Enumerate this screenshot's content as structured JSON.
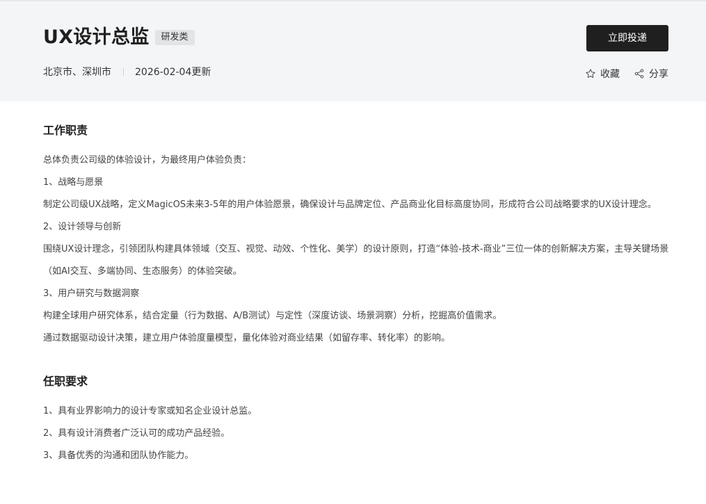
{
  "job": {
    "title": "UX设计总监",
    "category": "研发类",
    "locations": "北京市、深圳市",
    "updated": "2026-02-04更新"
  },
  "actions": {
    "apply_label": "立即投递",
    "favorite_label": "收藏",
    "share_label": "分享",
    "favorite_icon": "star-outline-icon",
    "share_icon": "share-nodes-icon"
  },
  "responsibilities": {
    "title": "工作职责",
    "lines": [
      "总体负责公司级的体验设计，为最终用户体验负责：",
      "1、战略与愿景",
      "制定公司级UX战略，定义MagicOS未来3-5年的用户体验愿景，确保设计与品牌定位、产品商业化目标高度协同，形成符合公司战略要求的UX设计理念。",
      "2、设计领导与创新",
      "围绕UX设计理念，引领团队构建具体领域（交互、视觉、动效、个性化、美学）的设计原则，打造“体验-技术-商业”三位一体的创新解决方案，主导关键场景（如AI交互、多端协同、生态服务）的体验突破。",
      "3、用户研究与数据洞察",
      "构建全球用户研究体系，结合定量（行为数据、A/B测试）与定性（深度访谈、场景洞察）分析，挖掘高价值需求。",
      "通过数据驱动设计决策，建立用户体验度量模型，量化体验对商业结果（如留存率、转化率）的影响。"
    ]
  },
  "requirements": {
    "title": "任职要求",
    "lines": [
      "1、具有业界影响力的设计专家或知名企业设计总监。",
      "2、具有设计消费者广泛认可的成功产品经验。",
      "3、具备优秀的沟通和团队协作能力。"
    ]
  },
  "colors": {
    "header_bg": "#f4f5f7",
    "primary_button": "#1f1f1f",
    "tag_bg": "#e3e4e7",
    "text_primary": "#1f1f1f",
    "text_body": "#444444"
  }
}
